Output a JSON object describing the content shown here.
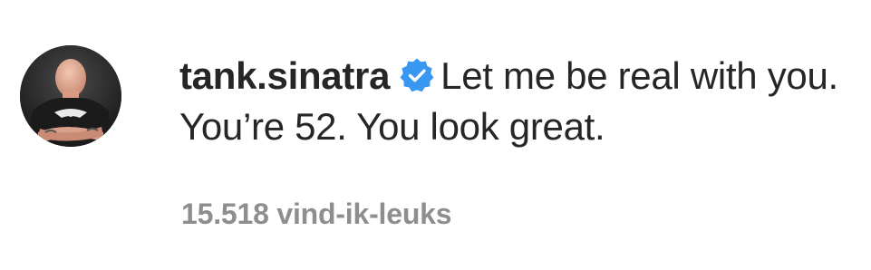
{
  "comment": {
    "username": "tank.sinatra",
    "verified_icon": "verified-badge-icon",
    "text": "Let me be real with you. You’re 52. You look great.",
    "likes": "15.518 vind-ik-leuks"
  },
  "colors": {
    "text": "#262626",
    "muted": "#8e8e8e",
    "verified": "#3897f0"
  }
}
